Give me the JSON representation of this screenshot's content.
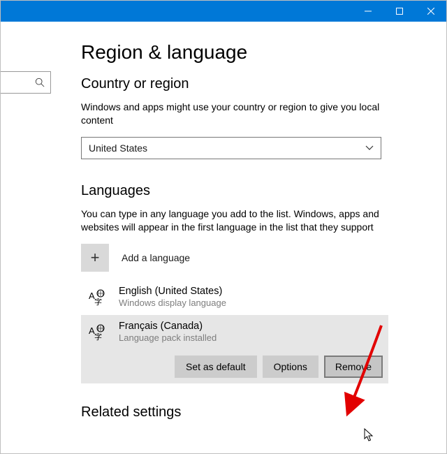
{
  "header": {
    "title": "Region & language"
  },
  "country": {
    "heading": "Country or region",
    "desc": "Windows and apps might use your country or region to give you local content",
    "selected": "United States"
  },
  "languages": {
    "heading": "Languages",
    "desc": "You can type in any language you add to the list. Windows, apps and websites will appear in the first language in the list that they support",
    "add_label": "Add a language",
    "items": [
      {
        "name": "English (United States)",
        "status": "Windows display language"
      },
      {
        "name": "Français (Canada)",
        "status": "Language pack installed"
      }
    ],
    "buttons": {
      "set_default": "Set as default",
      "options": "Options",
      "remove": "Remove"
    }
  },
  "related": {
    "heading": "Related settings"
  }
}
